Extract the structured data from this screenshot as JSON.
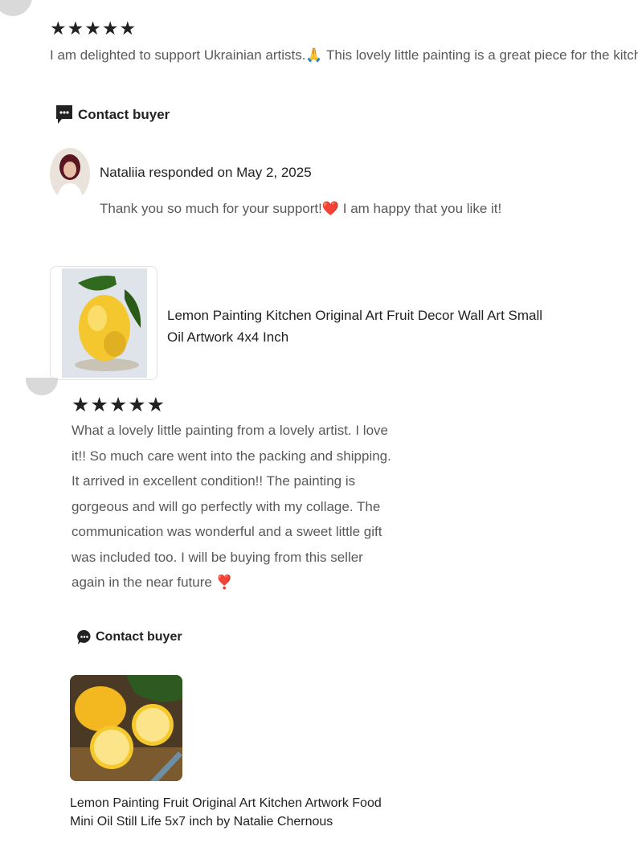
{
  "review1": {
    "rating": 5,
    "stars": "★★★★★",
    "text": "I am delighted to support Ukrainian artists.🙏 This lovely little painting is a great piece for the kitchen!",
    "contact_label": "Contact buyer",
    "response": {
      "header": "Nataliia responded on May 2, 2025",
      "text": "Thank you so much for your support!❤️ I am happy that you like it!"
    },
    "item_title": "Lemon Painting Kitchen Original Art Fruit Decor Wall Art Small Oil Artwork 4x4 Inch"
  },
  "review2": {
    "rating": 5,
    "stars": "★★★★★",
    "text": "What a lovely little painting from a lovely artist. I love it!! So much care went into the packing and shipping. It arrived in excellent condition!! The painting is gorgeous and will go perfectly with my collage. The communication was wonderful and a sweet little gift was included too. I will be buying from this seller again in the near future ❣️",
    "contact_label": "Contact buyer",
    "item_title": "Lemon Painting Fruit Original Art Kitchen Artwork Food Mini Oil Still Life 5x7 inch by Natalie Chernous"
  },
  "icons": {
    "chat": "chat-bubble-icon",
    "heart": "heart-icon"
  },
  "colors": {
    "text_primary": "#222222",
    "text_secondary": "#595959",
    "heart_red": "#d0021b",
    "lemon": "#f5c518"
  }
}
